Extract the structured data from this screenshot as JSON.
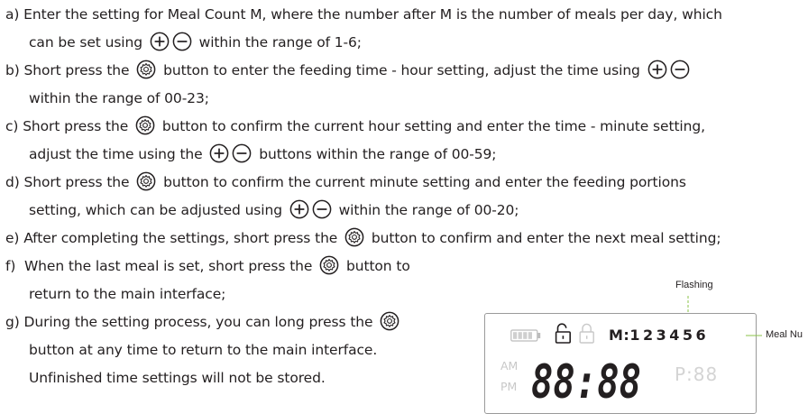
{
  "steps": {
    "a1": "a) Enter the setting for Meal Count M, where the number after M is the number of meals per day, which",
    "a2a": "can be set using",
    "a2b": "within the range of 1-6;",
    "b1a": "b) Short press the",
    "b1b": "button to enter the feeding time - hour setting, adjust the time using",
    "b2": "within the range of 00-23;",
    "c1a": "c) Short press the",
    "c1b": "button to confirm the current hour setting and enter the time - minute setting,",
    "c2a": "adjust the time using the",
    "c2b": "buttons within the range of 00-59;",
    "d1a": "d) Short press the",
    "d1b": "button to confirm the current minute setting and enter the feeding portions",
    "d2a": "setting, which can be adjusted using",
    "d2b": "within the range of 00-20;",
    "e1a": "e) After completing the settings, short press the",
    "e1b": "button to confirm and enter the next meal setting;",
    "f1a": "f)  When the last meal is set, short press the",
    "f1b": "button to",
    "f2": "return to the main interface;",
    "g1a": "g) During the setting process, you can long press the",
    "g2": "button at any time to return to the main interface.",
    "g3": "Unfinished time settings will not be stored."
  },
  "icons": {
    "plus": "plus-button-icon",
    "minus": "minus-button-icon",
    "settings": "settings-button-icon",
    "battery": "battery-icon",
    "unlocked": "unlocked-icon",
    "locked": "locked-icon"
  },
  "display": {
    "meal_prefix": "M:",
    "meal_digits": "123456",
    "am": "AM",
    "pm": "PM",
    "time": "88:88",
    "portions": "P:88"
  },
  "annotations": {
    "flashing": "Flashing",
    "meal_number": "Meal Nu"
  }
}
